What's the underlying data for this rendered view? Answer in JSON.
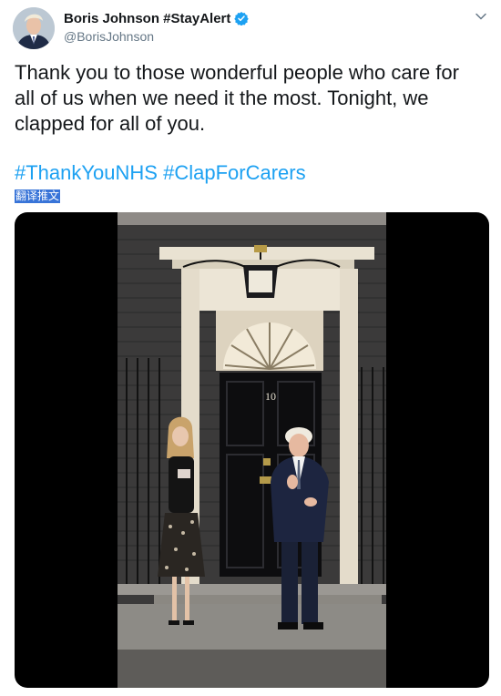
{
  "tweet": {
    "author_name": "Boris Johnson #StayAlert",
    "author_handle": "@BorisJohnson",
    "text": "Thank you to those wonderful people who care for\nall of us when we need it the most. Tonight, we\nclapped for all of you.",
    "hashtags": [
      "#ThankYouNHS",
      "#ClapForCarers"
    ],
    "translate_label": "翻译推文"
  },
  "media": {
    "door_number": "10"
  },
  "colors": {
    "link": "#1da1f2",
    "verified": "#1da1f2",
    "translate_highlight": "#3874d8"
  }
}
